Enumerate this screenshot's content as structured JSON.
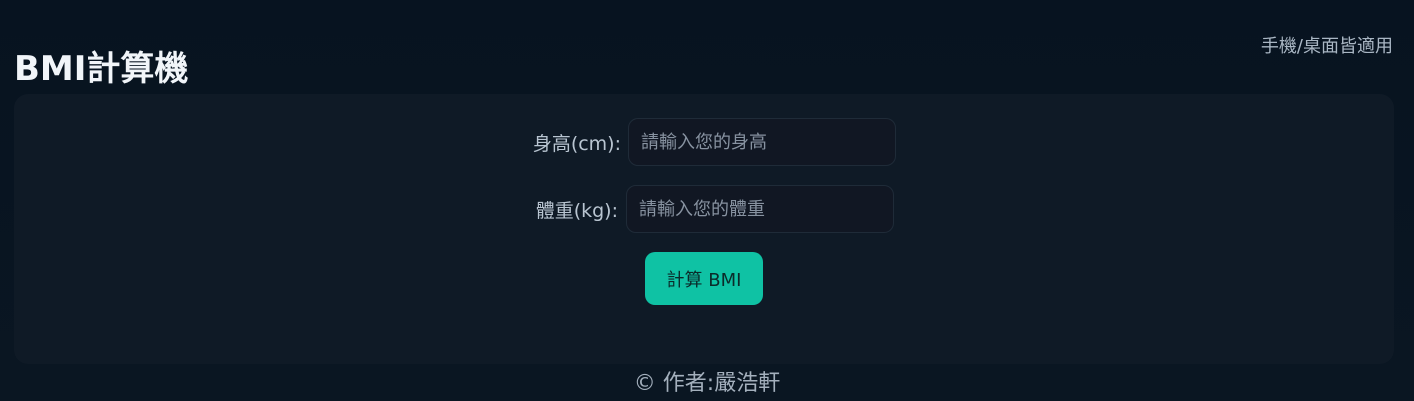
{
  "header": {
    "title": "BMI計算機",
    "note": "手機/桌面皆適用"
  },
  "form": {
    "height": {
      "label": "身高(cm):",
      "value": "",
      "placeholder": "請輸入您的身高"
    },
    "weight": {
      "label": "體重(kg):",
      "value": "",
      "placeholder": "請輸入您的體重"
    },
    "submit_label": "計算 BMI"
  },
  "footer": {
    "text": "© 作者:嚴浩軒"
  },
  "colors": {
    "background": "#08131f",
    "card": "#0f1a26",
    "accent": "#0fc2a4"
  }
}
